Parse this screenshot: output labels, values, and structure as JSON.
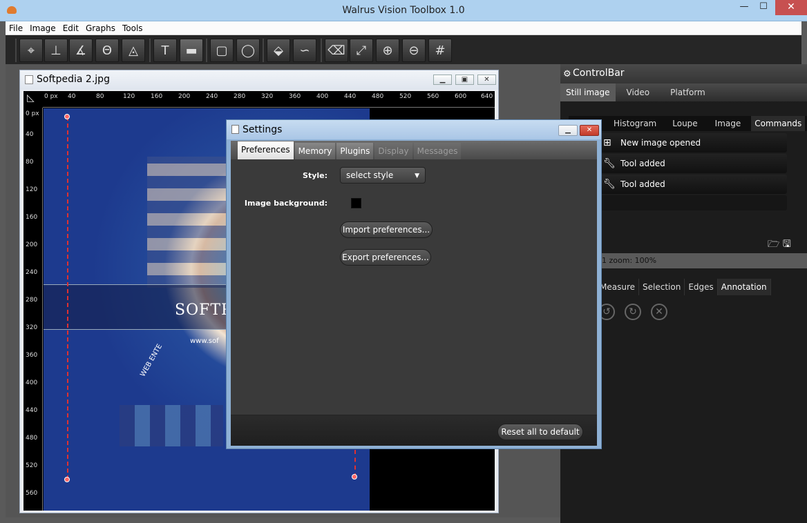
{
  "window": {
    "title": "Walrus Vision Toolbox 1.0",
    "min": "—",
    "max": "☐",
    "close": "✕"
  },
  "menu": [
    "File",
    "Image",
    "Edit",
    "Graphs",
    "Tools"
  ],
  "toolbar": {
    "tools": [
      {
        "name": "crosshair-tool-icon",
        "glyph": "⌖"
      },
      {
        "name": "distance-tool-icon",
        "glyph": "⊥"
      },
      {
        "name": "angle-tool-icon",
        "glyph": "∡"
      },
      {
        "name": "circle-tool-icon",
        "glyph": "Θ"
      },
      {
        "name": "triangle-tool-icon",
        "glyph": "◬"
      },
      {
        "name": "text-tool-icon",
        "glyph": "T"
      },
      {
        "name": "line-style-tool-icon",
        "glyph": "▬"
      },
      {
        "name": "rect-select-tool-icon",
        "glyph": "▢"
      },
      {
        "name": "ellipse-select-tool-icon",
        "glyph": "◯"
      },
      {
        "name": "fill-tool-icon",
        "glyph": "⬙"
      },
      {
        "name": "path-tool-icon",
        "glyph": "∽"
      },
      {
        "name": "eraser-tool-icon",
        "glyph": "⌫"
      },
      {
        "name": "resize-tool-icon",
        "glyph": "⤢"
      },
      {
        "name": "zoom-in-tool-icon",
        "glyph": "⊕"
      },
      {
        "name": "zoom-out-tool-icon",
        "glyph": "⊖"
      },
      {
        "name": "grid-tool-icon",
        "glyph": "#"
      }
    ]
  },
  "image_window": {
    "title": "Softpedia 2.jpg",
    "h_ruler": [
      "0 px",
      "40",
      "80",
      "120",
      "160",
      "200",
      "240",
      "280",
      "320",
      "360",
      "400",
      "440",
      "480",
      "520",
      "560",
      "600",
      "640"
    ],
    "v_ruler": [
      "0 px",
      "40",
      "80",
      "120",
      "160",
      "200",
      "240",
      "280",
      "320",
      "360",
      "400",
      "440",
      "480",
      "520",
      "560"
    ],
    "photo_text": "SOFTP",
    "photo_url": "www.sof",
    "photo_web": "WEB ENTE"
  },
  "controlbar": {
    "title": "ControlBar",
    "tabs": [
      "Still image",
      "Video",
      "Platform"
    ],
    "subtabs": [
      "Histogram",
      "Loupe",
      "Image",
      "Commands"
    ],
    "commands": [
      "New image opened",
      "Tool added",
      "Tool added"
    ],
    "zoom_text": "1 zoom: 100%",
    "bottom_tabs": [
      "Measure",
      "Selection",
      "Edges",
      "Annotation"
    ]
  },
  "settings": {
    "title": "Settings",
    "tabs": [
      "Preferences",
      "Memory",
      "Plugins",
      "Display",
      "Messages"
    ],
    "style_label": "Style:",
    "style_value": "select style",
    "bg_label": "Image background:",
    "import_btn": "Import preferences...",
    "export_btn": "Export preferences...",
    "reset_btn": "Reset all to default"
  },
  "colors": {
    "accent_title": "#aed1ef",
    "dark_bg": "#1c1c1c",
    "close_red": "#c75050"
  }
}
